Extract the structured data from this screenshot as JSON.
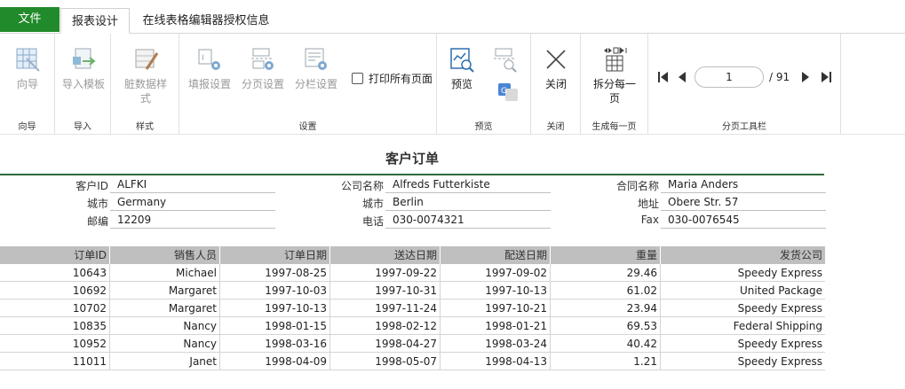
{
  "tabs": {
    "file": "文件",
    "report_design": "报表设计",
    "license_info": "在线表格编辑器授权信息"
  },
  "ribbon": {
    "wizard": {
      "button": "向导",
      "group": "向导"
    },
    "import": {
      "button": "导入模板",
      "group": "导入"
    },
    "style": {
      "button_line1": "脏数据样",
      "button_line2": "式",
      "group": "样式"
    },
    "settings": {
      "fill_setting": "填报设置",
      "page_setting": "分页设置",
      "column_setting": "分栏设置",
      "print_all": "打印所有页面",
      "group": "设置"
    },
    "preview": {
      "button": "预览",
      "group": "预览"
    },
    "close": {
      "button": "关闭",
      "group": "关闭"
    },
    "generate": {
      "button_line1": "拆分每一",
      "button_line2": "页",
      "group": "生成每一页"
    },
    "pager": {
      "current": "1",
      "total": "/ 91",
      "group": "分页工具栏"
    }
  },
  "report": {
    "title": "客户订单",
    "info": {
      "customer_id_label": "客户ID",
      "customer_id": "ALFKI",
      "company_label": "公司名称",
      "company": "Alfreds Futterkiste",
      "contact_label": "合同名称",
      "contact": "Maria Anders",
      "city_label": "城市",
      "city": "Germany",
      "city2_label": "城市",
      "city2": "Berlin",
      "address_label": "地址",
      "address": "Obere Str. 57",
      "postcode_label": "邮编",
      "postcode": "12209",
      "phone_label": "电话",
      "phone": "030-0074321",
      "fax_label": "Fax",
      "fax": "030-0076545"
    },
    "columns": [
      "订单ID",
      "销售人员",
      "订单日期",
      "送达日期",
      "配送日期",
      "重量",
      "发货公司"
    ],
    "rows": [
      [
        "10643",
        "Michael",
        "1997-08-25",
        "1997-09-22",
        "1997-09-02",
        "29.46",
        "Speedy Express"
      ],
      [
        "10692",
        "Margaret",
        "1997-10-03",
        "1997-10-31",
        "1997-10-13",
        "61.02",
        "United Package"
      ],
      [
        "10702",
        "Margaret",
        "1997-10-13",
        "1997-11-24",
        "1997-10-21",
        "23.94",
        "Speedy Express"
      ],
      [
        "10835",
        "Nancy",
        "1998-01-15",
        "1998-02-12",
        "1998-01-21",
        "69.53",
        "Federal Shipping"
      ],
      [
        "10952",
        "Nancy",
        "1998-03-16",
        "1998-04-27",
        "1998-03-24",
        "40.42",
        "Speedy Express"
      ],
      [
        "11011",
        "Janet",
        "1998-04-09",
        "1998-05-07",
        "1998-04-13",
        "1.21",
        "Speedy Express"
      ]
    ]
  },
  "colors": {
    "file_tab": "#218a2a",
    "accent_line": "#2e6b3a",
    "header_bg": "#bfbfbf"
  }
}
